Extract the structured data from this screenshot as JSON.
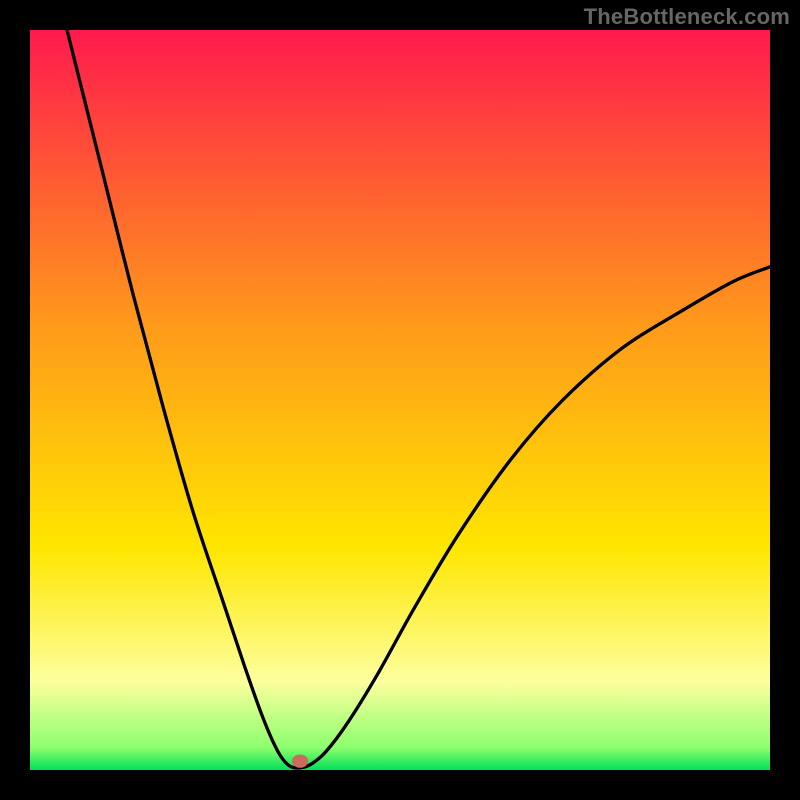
{
  "watermark": "TheBottleneck.com",
  "chart_data": {
    "type": "line",
    "title": "",
    "xlabel": "",
    "ylabel": "",
    "xlim": [
      0,
      100
    ],
    "ylim": [
      0,
      100
    ],
    "background_gradient_stops": [
      {
        "offset": 0.0,
        "color": "#ff1a4d"
      },
      {
        "offset": 0.4,
        "color": "#ff9a1a"
      },
      {
        "offset": 0.7,
        "color": "#ffe600"
      },
      {
        "offset": 0.88,
        "color": "#fdff9e"
      },
      {
        "offset": 0.97,
        "color": "#8cff6e"
      },
      {
        "offset": 1.0,
        "color": "#00e05a"
      }
    ],
    "curve_points": [
      {
        "x": 5.0,
        "y": 100.0
      },
      {
        "x": 7.0,
        "y": 92.0
      },
      {
        "x": 10.0,
        "y": 80.0
      },
      {
        "x": 14.0,
        "y": 64.0
      },
      {
        "x": 18.0,
        "y": 49.0
      },
      {
        "x": 22.0,
        "y": 35.0
      },
      {
        "x": 26.0,
        "y": 23.0
      },
      {
        "x": 29.0,
        "y": 14.0
      },
      {
        "x": 31.5,
        "y": 7.0
      },
      {
        "x": 33.5,
        "y": 2.5
      },
      {
        "x": 35.0,
        "y": 0.6
      },
      {
        "x": 36.5,
        "y": 0.3
      },
      {
        "x": 38.0,
        "y": 0.8
      },
      {
        "x": 40.0,
        "y": 2.5
      },
      {
        "x": 43.0,
        "y": 6.5
      },
      {
        "x": 47.0,
        "y": 13.0
      },
      {
        "x": 52.0,
        "y": 22.0
      },
      {
        "x": 58.0,
        "y": 32.0
      },
      {
        "x": 65.0,
        "y": 42.0
      },
      {
        "x": 72.0,
        "y": 50.0
      },
      {
        "x": 80.0,
        "y": 57.0
      },
      {
        "x": 88.0,
        "y": 62.0
      },
      {
        "x": 95.0,
        "y": 66.0
      },
      {
        "x": 100.0,
        "y": 68.0
      }
    ],
    "marker": {
      "x": 36.5,
      "y": 1.2,
      "rx": 1.1,
      "ry": 0.9,
      "color": "#c96b5d"
    }
  }
}
